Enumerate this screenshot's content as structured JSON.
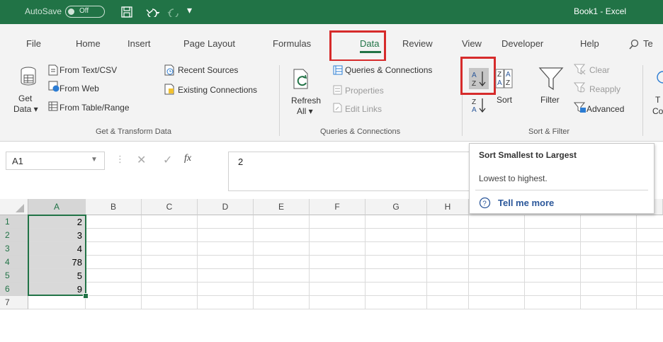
{
  "title_bar": {
    "autosave_label": "AutoSave",
    "autosave_state": "Off",
    "document_title": "Book1  -  Excel"
  },
  "tabs": [
    {
      "label": "File"
    },
    {
      "label": "Home"
    },
    {
      "label": "Insert"
    },
    {
      "label": "Page Layout"
    },
    {
      "label": "Formulas"
    },
    {
      "label": "Data",
      "active": true
    },
    {
      "label": "Review"
    },
    {
      "label": "View"
    },
    {
      "label": "Developer"
    },
    {
      "label": "Help"
    },
    {
      "label": "Te"
    }
  ],
  "ribbon": {
    "get_data": {
      "line1": "Get",
      "line2": "Data ▾"
    },
    "from_text_csv": "From Text/CSV",
    "from_web": "From Web",
    "from_table_range": "From Table/Range",
    "recent_sources": "Recent Sources",
    "existing_connections": "Existing Connections",
    "group_get_transform": "Get & Transform Data",
    "refresh": {
      "line1": "Refresh",
      "line2": "All ▾"
    },
    "queries_connections": "Queries & Connections",
    "properties": "Properties",
    "edit_links": "Edit Links",
    "group_queries_connections": "Queries & Connections",
    "sort": "Sort",
    "filter": "Filter",
    "clear": "Clear",
    "reapply": "Reapply",
    "advanced": "Advanced",
    "group_sort_filter": "Sort & Filter",
    "cut_off": {
      "line1": "T",
      "line2": "Co"
    }
  },
  "formula_bar": {
    "name_box": "A1",
    "fx_label": "fx",
    "value": "2"
  },
  "grid": {
    "columns": [
      "A",
      "B",
      "C",
      "D",
      "E",
      "F",
      "G",
      "H"
    ],
    "rows": [
      "1",
      "2",
      "3",
      "4",
      "5",
      "6",
      "7"
    ],
    "col_a_values": [
      "2",
      "3",
      "4",
      "78",
      "5",
      "9",
      ""
    ]
  },
  "tooltip": {
    "title": "Sort Smallest to Largest",
    "description": "Lowest to highest.",
    "link": "Tell me more"
  },
  "colors": {
    "excel_green": "#217346",
    "highlight_red": "#d62b2b",
    "link_blue": "#2b579a"
  }
}
